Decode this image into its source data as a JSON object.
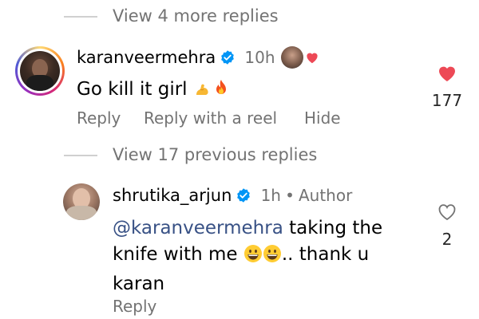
{
  "thread1": {
    "view_more": "View 4 more replies"
  },
  "comment1": {
    "username": "karanveermehra",
    "time": "10h",
    "text": "Go kill it girl",
    "emojis": [
      "flexed-biceps-icon",
      "fire-icon"
    ],
    "like_count": "177",
    "liked": true,
    "actions": {
      "reply": "Reply",
      "reply_reel": "Reply with a reel",
      "hide": "Hide"
    }
  },
  "thread2": {
    "view_previous": "View 17 previous replies"
  },
  "comment2": {
    "username": "shrutika_arjun",
    "time": "1h",
    "separator": "•",
    "author_tag": "Author",
    "mention": "@karanveermehra",
    "text_part1": "taking the",
    "text_part2": "knife with me",
    "text_part3": ".. thank u",
    "text_part4": "karan",
    "emojis": [
      "grinning-face-icon",
      "grinning-face-icon"
    ],
    "like_count": "2",
    "liked": false,
    "actions": {
      "reply": "Reply"
    }
  },
  "colors": {
    "like_red": "#ed4956",
    "verified_blue": "#0095f6",
    "muted_text": "#737373",
    "mention_blue": "#385185"
  }
}
